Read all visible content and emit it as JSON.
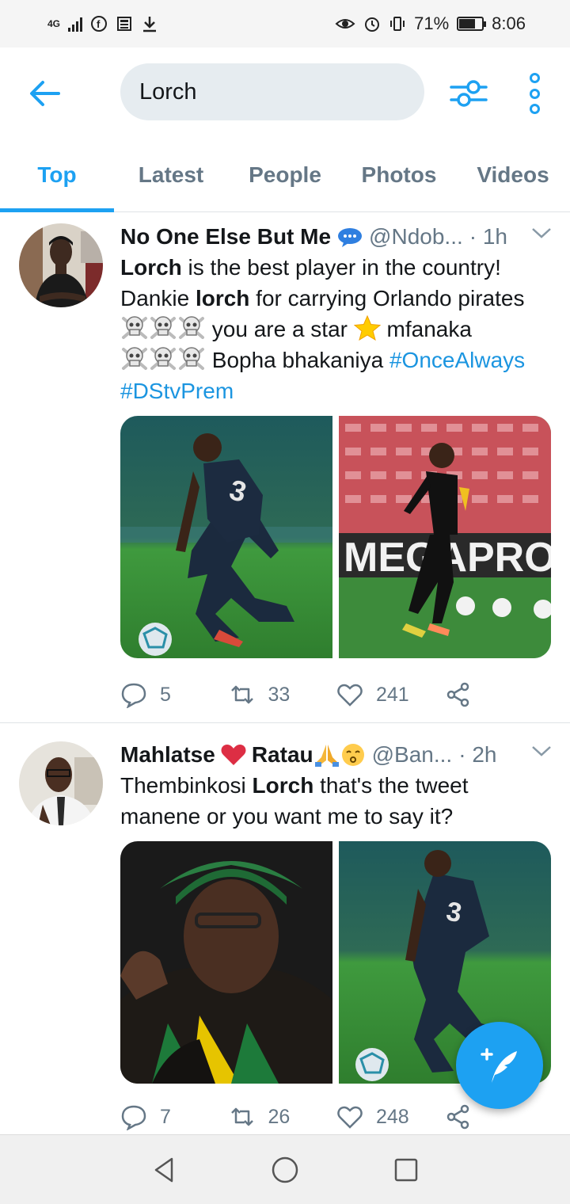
{
  "status_bar": {
    "network": "4G",
    "battery": "71%",
    "battery_level": 0.71,
    "time": "8:06"
  },
  "search": {
    "query": "Lorch"
  },
  "tabs": [
    {
      "label": "Top",
      "active": true
    },
    {
      "label": "Latest",
      "active": false
    },
    {
      "label": "People",
      "active": false
    },
    {
      "label": "Photos",
      "active": false
    },
    {
      "label": "Videos",
      "active": false
    }
  ],
  "tweets": [
    {
      "name": "No One Else But Me",
      "handle": "@Ndob...",
      "time": "· 1h",
      "text": {
        "l1a": "Lorch",
        "l1b": " is the best player in the country!",
        "l2a": "Dankie ",
        "l2b": "lorch",
        "l2c": " for carrying Orlando pirates",
        "l3a": " you are a star ",
        "l3b": " mfanaka",
        "l4a": " Bopha bhakaniya ",
        "tag1": "#OnceAlways",
        "tag2": "#DStvPrem"
      },
      "replies": "5",
      "retweets": "33",
      "likes": "241"
    },
    {
      "name": "Mahlatse",
      "name2": "Ratau",
      "handle": "@Ban...",
      "time": "· 2h",
      "text": {
        "l1a": "Thembinkosi ",
        "l1b": "Lorch",
        "l1c": " that's the tweet",
        "l2": "manene or you want me to say it?"
      },
      "replies": "7",
      "retweets": "26",
      "likes": "248"
    }
  ],
  "media_text": {
    "jersey": "3",
    "banner": "MEGAPRO"
  },
  "colors": {
    "accent": "#1da1f2",
    "text": "#14171a",
    "muted": "#657786"
  }
}
